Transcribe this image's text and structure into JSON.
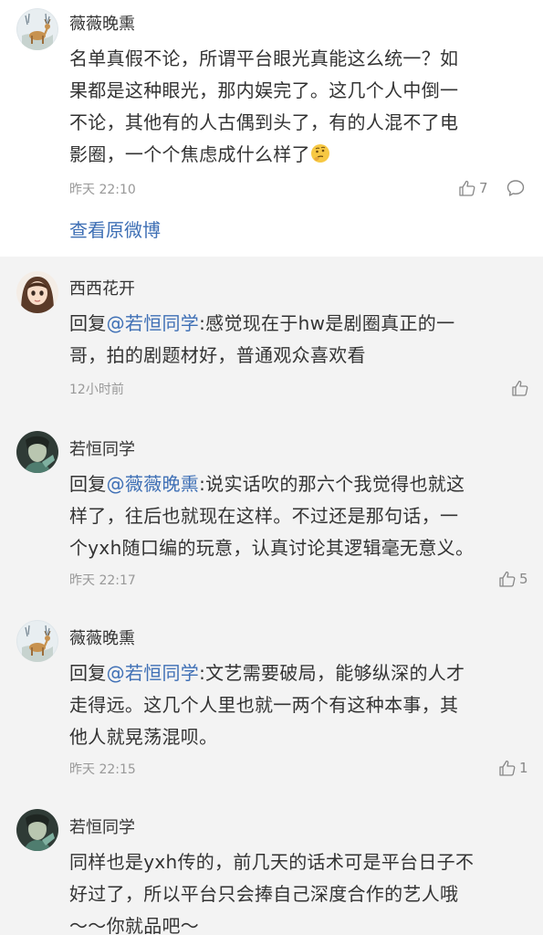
{
  "post": {
    "username": "薇薇晚熏",
    "text_lines": [
      "名单真假不论，所谓平台眼光真能这么统一？如",
      "果都是这种眼光，那内娱完了。这几个人中倒一",
      "不论，其他有的人古偶到头了，有的人混不了电",
      "影圈，一个个焦虑成什么样了"
    ],
    "emoji": "thinking-face-emoji",
    "time": "昨天 22:10",
    "like_count": "7",
    "view_original": "查看原微博"
  },
  "replies": [
    {
      "username": "西西花开",
      "prefix": "回复",
      "mention": "@若恒同学",
      "line1_rest": ":感觉现在于hw是剧圈真正的一",
      "lines": [
        "哥，拍的剧题材好，普通观众喜欢看"
      ],
      "time": "12小时前",
      "like_count": ""
    },
    {
      "username": "若恒同学",
      "prefix": "回复",
      "mention": "@薇薇晚熏",
      "line1_rest": ":说实话吹的那六个我觉得也就这",
      "lines": [
        "样了，往后也就现在这样。不过还是那句话，一",
        "个yxh随口编的玩意，认真讨论其逻辑毫无意义。"
      ],
      "time": "昨天 22:17",
      "like_count": "5"
    },
    {
      "username": "薇薇晚熏",
      "prefix": "回复",
      "mention": "@若恒同学",
      "line1_rest": ":文艺需要破局，能够纵深的人才",
      "lines": [
        "走得远。这几个人里也就一两个有这种本事，其",
        "他人就晃荡混呗。"
      ],
      "time": "昨天 22:15",
      "like_count": "1"
    },
    {
      "username": "若恒同学",
      "text_lines": [
        "同样也是yxh传的，前几天的话术可是平台日子不",
        "好过了，所以平台只会捧自己深度合作的艺人哦",
        "～～你就品吧～"
      ]
    }
  ],
  "colors": {
    "link": "#3e6fb5",
    "reply_bg": "#f3f3f3",
    "text": "#333333",
    "meta": "#999999"
  }
}
